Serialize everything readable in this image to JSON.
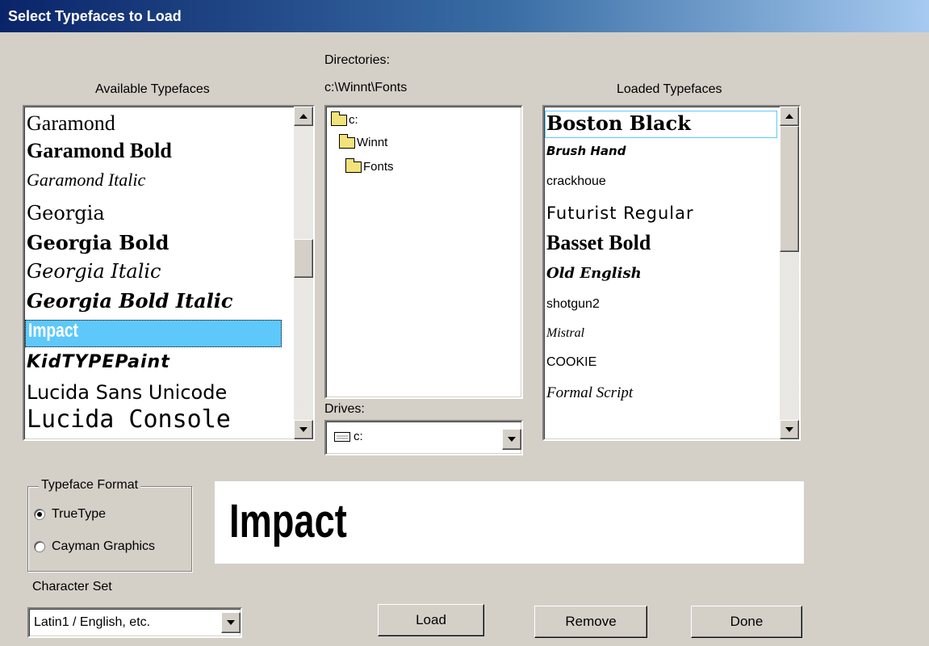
{
  "window": {
    "title": "Select Typefaces to Load"
  },
  "available": {
    "label": "Available Typefaces",
    "items": [
      "Garamond",
      "Garamond Bold",
      "Garamond Italic",
      "Georgia",
      "Georgia Bold",
      "Georgia Italic",
      "Georgia Bold Italic",
      "Impact",
      "KidTYPEPaint",
      "Lucida Sans Unicode",
      "Lucida Console"
    ],
    "selected": "Impact"
  },
  "directories": {
    "label": "Directories:",
    "path": "c:\\Winnt\\Fonts",
    "tree": [
      "c:",
      "Winnt",
      "Fonts"
    ],
    "drives_label": "Drives:",
    "drive": "c:"
  },
  "loaded": {
    "label": "Loaded Typefaces",
    "items": [
      "Boston Black",
      "Brush Hand",
      "crackhoue",
      "Futurist Regular",
      "Basset Bold",
      "Old English",
      "shotgun2",
      "Mistral",
      "COOKIE",
      "Formal Script"
    ]
  },
  "format": {
    "label": "Typeface Format",
    "options": [
      "TrueType",
      "Cayman Graphics"
    ],
    "selected": "TrueType"
  },
  "preview": {
    "text": "Impact"
  },
  "charset": {
    "label": "Character Set",
    "value": "Latin1 / English, etc."
  },
  "buttons": {
    "load": "Load",
    "remove": "Remove",
    "done": "Done"
  },
  "colors": {
    "selection": "#5ec8fb",
    "title_start": "#0a246a",
    "title_end": "#a6caf0"
  }
}
